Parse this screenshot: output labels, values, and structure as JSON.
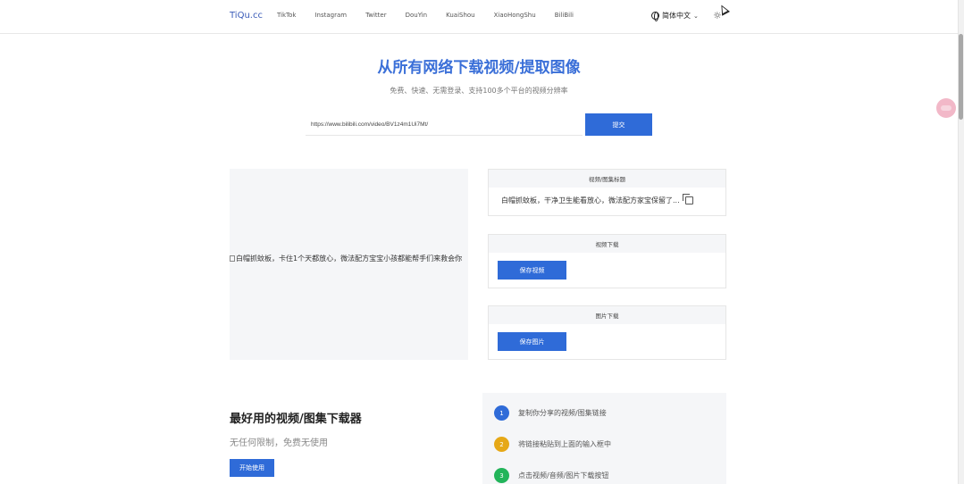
{
  "header": {
    "logo": "TiQu.cc",
    "nav": [
      "TikTok",
      "Instagram",
      "Twitter",
      "DouYin",
      "KuaiShou",
      "XiaoHongShu",
      "BiliBili"
    ],
    "language": "简体中文",
    "theme_glyph": "☼"
  },
  "hero": {
    "title": "从所有网络下载视频/提取图像",
    "subtitle": "免费、快速、无需登录、支持100多个平台的视频分辨率",
    "input_value": "https://www.bilibili.com/video/BV1z4m1Ui7Mt/",
    "submit_label": "提交"
  },
  "preview": {
    "alt_text": "白帽抓蚊板，卡住1个天都放心，微法配方宝宝小孩都能帮手们来救会你"
  },
  "panels": {
    "title": {
      "header": "视频/图集标题",
      "value": "白帽抓蚊板，干净卫生能看放心，微法配方家宝保留了..."
    },
    "video": {
      "header": "视频下载",
      "button": "保存视频"
    },
    "image": {
      "header": "图片下载",
      "button": "保存图片"
    }
  },
  "features": {
    "title": "最好用的视频/图集下载器",
    "subtitle": "无任何限制，免费无使用",
    "button": "开始使用"
  },
  "steps": [
    {
      "num": "1",
      "text": "复制你分享的视频/图集链接",
      "color": "#2f6bd8"
    },
    {
      "num": "2",
      "text": "将链接粘贴到上面的输入框中",
      "color": "#e6a817"
    },
    {
      "num": "3",
      "text": "点击视频/音频/图片下载按钮",
      "color": "#22b45a"
    }
  ]
}
